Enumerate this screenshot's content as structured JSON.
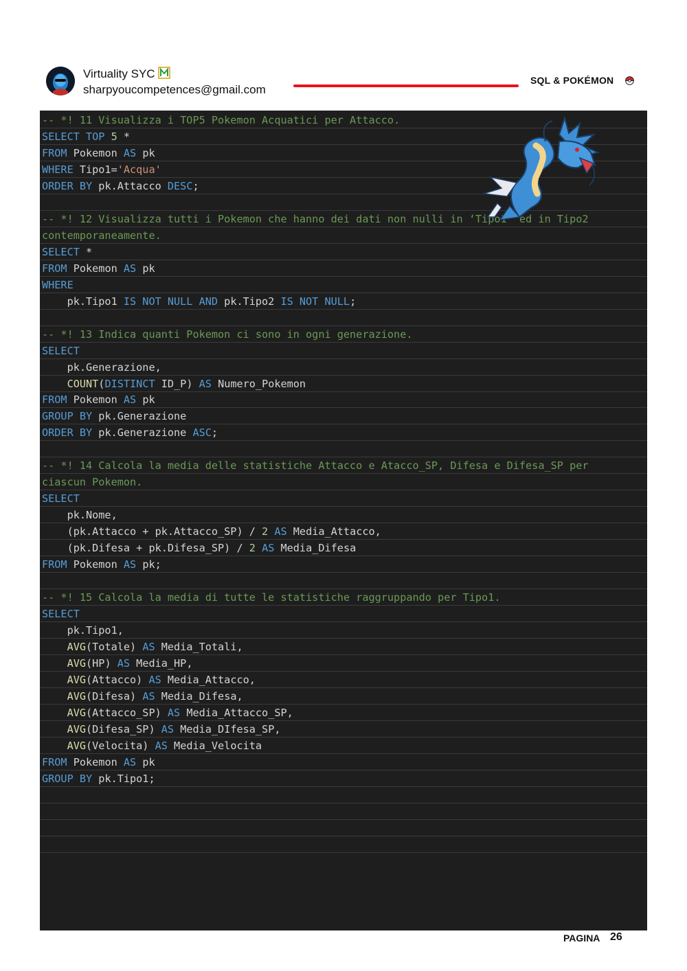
{
  "header": {
    "brand_name": "Virtuality SYC",
    "email": "sharpyoucompetences@gmail.com",
    "doc_title": "SQL & POKÉMON",
    "accent_color": "#e8141c"
  },
  "footer": {
    "page_label": "PAGINA",
    "page_number": "26"
  },
  "code": {
    "theme": {
      "keyword": "#569cd6",
      "comment": "#6a9955",
      "string": "#ce9178",
      "function": "#dcdcaa",
      "number": "#b5cea8",
      "text": "#d4d4d4",
      "background": "#1e1e1e"
    },
    "lines": [
      [
        {
          "t": "cm",
          "s": "-- *! 11 Visualizza i TOP5 Pokemon Acquatici per Attacco."
        }
      ],
      [
        {
          "t": "kw",
          "s": "SELECT TOP"
        },
        {
          "t": "tx",
          "s": " "
        },
        {
          "t": "num",
          "s": "5"
        },
        {
          "t": "tx",
          "s": " *"
        }
      ],
      [
        {
          "t": "kw",
          "s": "FROM"
        },
        {
          "t": "tx",
          "s": " Pokemon "
        },
        {
          "t": "kw",
          "s": "AS"
        },
        {
          "t": "tx",
          "s": " pk"
        }
      ],
      [
        {
          "t": "kw",
          "s": "WHERE"
        },
        {
          "t": "tx",
          "s": " Tipo1="
        },
        {
          "t": "str",
          "s": "'Acqua'"
        }
      ],
      [
        {
          "t": "kw",
          "s": "ORDER BY"
        },
        {
          "t": "tx",
          "s": " pk.Attacco "
        },
        {
          "t": "kw",
          "s": "DESC"
        },
        {
          "t": "tx",
          "s": ";"
        }
      ],
      [],
      [
        {
          "t": "cm",
          "s": "-- *! 12 Visualizza tutti i Pokemon che hanno dei dati non nulli in ‘Tipo1’ ed in Tipo2"
        }
      ],
      [
        {
          "t": "cm",
          "s": "contemporaneamente."
        }
      ],
      [
        {
          "t": "kw",
          "s": "SELECT"
        },
        {
          "t": "tx",
          "s": " *"
        }
      ],
      [
        {
          "t": "kw",
          "s": "FROM"
        },
        {
          "t": "tx",
          "s": " Pokemon "
        },
        {
          "t": "kw",
          "s": "AS"
        },
        {
          "t": "tx",
          "s": " pk"
        }
      ],
      [
        {
          "t": "kw",
          "s": "WHERE"
        }
      ],
      [
        {
          "t": "tx",
          "s": "    pk.Tipo1 "
        },
        {
          "t": "kw",
          "s": "IS NOT NULL AND"
        },
        {
          "t": "tx",
          "s": " pk.Tipo2 "
        },
        {
          "t": "kw",
          "s": "IS NOT NULL"
        },
        {
          "t": "tx",
          "s": ";"
        }
      ],
      [],
      [
        {
          "t": "cm",
          "s": "-- *! 13 Indica quanti Pokemon ci sono in ogni generazione."
        }
      ],
      [
        {
          "t": "kw",
          "s": "SELECT"
        }
      ],
      [
        {
          "t": "tx",
          "s": "    pk.Generazione,"
        }
      ],
      [
        {
          "t": "tx",
          "s": "    "
        },
        {
          "t": "fn",
          "s": "COUNT"
        },
        {
          "t": "tx",
          "s": "("
        },
        {
          "t": "kw",
          "s": "DISTINCT"
        },
        {
          "t": "tx",
          "s": " ID_P) "
        },
        {
          "t": "kw",
          "s": "AS"
        },
        {
          "t": "tx",
          "s": " Numero_Pokemon"
        }
      ],
      [
        {
          "t": "kw",
          "s": "FROM"
        },
        {
          "t": "tx",
          "s": " Pokemon "
        },
        {
          "t": "kw",
          "s": "AS"
        },
        {
          "t": "tx",
          "s": " pk"
        }
      ],
      [
        {
          "t": "kw",
          "s": "GROUP BY"
        },
        {
          "t": "tx",
          "s": " pk.Generazione"
        }
      ],
      [
        {
          "t": "kw",
          "s": "ORDER BY"
        },
        {
          "t": "tx",
          "s": " pk.Generazione "
        },
        {
          "t": "kw",
          "s": "ASC"
        },
        {
          "t": "tx",
          "s": ";"
        }
      ],
      [],
      [
        {
          "t": "cm",
          "s": "-- *! 14 Calcola la media delle statistiche Attacco e Atacco_SP, Difesa e Difesa_SP per"
        }
      ],
      [
        {
          "t": "cm",
          "s": "ciascun Pokemon."
        }
      ],
      [
        {
          "t": "kw",
          "s": "SELECT"
        }
      ],
      [
        {
          "t": "tx",
          "s": "    pk.Nome,"
        }
      ],
      [
        {
          "t": "tx",
          "s": "    (pk.Attacco + pk.Attacco_SP) / "
        },
        {
          "t": "num",
          "s": "2"
        },
        {
          "t": "tx",
          "s": " "
        },
        {
          "t": "kw",
          "s": "AS"
        },
        {
          "t": "tx",
          "s": " Media_Attacco,"
        }
      ],
      [
        {
          "t": "tx",
          "s": "    (pk.Difesa + pk.Difesa_SP) / "
        },
        {
          "t": "num",
          "s": "2"
        },
        {
          "t": "tx",
          "s": " "
        },
        {
          "t": "kw",
          "s": "AS"
        },
        {
          "t": "tx",
          "s": " Media_Difesa"
        }
      ],
      [
        {
          "t": "kw",
          "s": "FROM"
        },
        {
          "t": "tx",
          "s": " Pokemon "
        },
        {
          "t": "kw",
          "s": "AS"
        },
        {
          "t": "tx",
          "s": " pk;"
        }
      ],
      [],
      [
        {
          "t": "cm",
          "s": "-- *! 15 Calcola la media di tutte le statistiche raggruppando per Tipo1."
        }
      ],
      [
        {
          "t": "kw",
          "s": "SELECT"
        }
      ],
      [
        {
          "t": "tx",
          "s": "    pk.Tipo1,"
        }
      ],
      [
        {
          "t": "tx",
          "s": "    "
        },
        {
          "t": "fn",
          "s": "AVG"
        },
        {
          "t": "tx",
          "s": "(Totale) "
        },
        {
          "t": "kw",
          "s": "AS"
        },
        {
          "t": "tx",
          "s": " Media_Totali,"
        }
      ],
      [
        {
          "t": "tx",
          "s": "    "
        },
        {
          "t": "fn",
          "s": "AVG"
        },
        {
          "t": "tx",
          "s": "(HP) "
        },
        {
          "t": "kw",
          "s": "AS"
        },
        {
          "t": "tx",
          "s": " Media_HP,"
        }
      ],
      [
        {
          "t": "tx",
          "s": "    "
        },
        {
          "t": "fn",
          "s": "AVG"
        },
        {
          "t": "tx",
          "s": "(Attacco) "
        },
        {
          "t": "kw",
          "s": "AS"
        },
        {
          "t": "tx",
          "s": " Media_Attacco,"
        }
      ],
      [
        {
          "t": "tx",
          "s": "    "
        },
        {
          "t": "fn",
          "s": "AVG"
        },
        {
          "t": "tx",
          "s": "(Difesa) "
        },
        {
          "t": "kw",
          "s": "AS"
        },
        {
          "t": "tx",
          "s": " Media_Difesa,"
        }
      ],
      [
        {
          "t": "tx",
          "s": "    "
        },
        {
          "t": "fn",
          "s": "AVG"
        },
        {
          "t": "tx",
          "s": "(Attacco_SP) "
        },
        {
          "t": "kw",
          "s": "AS"
        },
        {
          "t": "tx",
          "s": " Media_Attacco_SP,"
        }
      ],
      [
        {
          "t": "tx",
          "s": "    "
        },
        {
          "t": "fn",
          "s": "AVG"
        },
        {
          "t": "tx",
          "s": "(Difesa_SP) "
        },
        {
          "t": "kw",
          "s": "AS"
        },
        {
          "t": "tx",
          "s": " Media_DIfesa_SP,"
        }
      ],
      [
        {
          "t": "tx",
          "s": "    "
        },
        {
          "t": "fn",
          "s": "AVG"
        },
        {
          "t": "tx",
          "s": "(Velocita) "
        },
        {
          "t": "kw",
          "s": "AS"
        },
        {
          "t": "tx",
          "s": " Media_Velocita"
        }
      ],
      [
        {
          "t": "kw",
          "s": "FROM"
        },
        {
          "t": "tx",
          "s": " Pokemon "
        },
        {
          "t": "kw",
          "s": "AS"
        },
        {
          "t": "tx",
          "s": " pk"
        }
      ],
      [
        {
          "t": "kw",
          "s": "GROUP BY"
        },
        {
          "t": "tx",
          "s": " pk.Tipo1;"
        }
      ],
      [],
      [],
      [],
      []
    ]
  },
  "decorations": {
    "avatar_icon": "avatar-icon",
    "brand_icon": "brand-logo-icon",
    "pokeball_icon": "pokeball-icon",
    "illustration": "gyarados-illustration"
  }
}
